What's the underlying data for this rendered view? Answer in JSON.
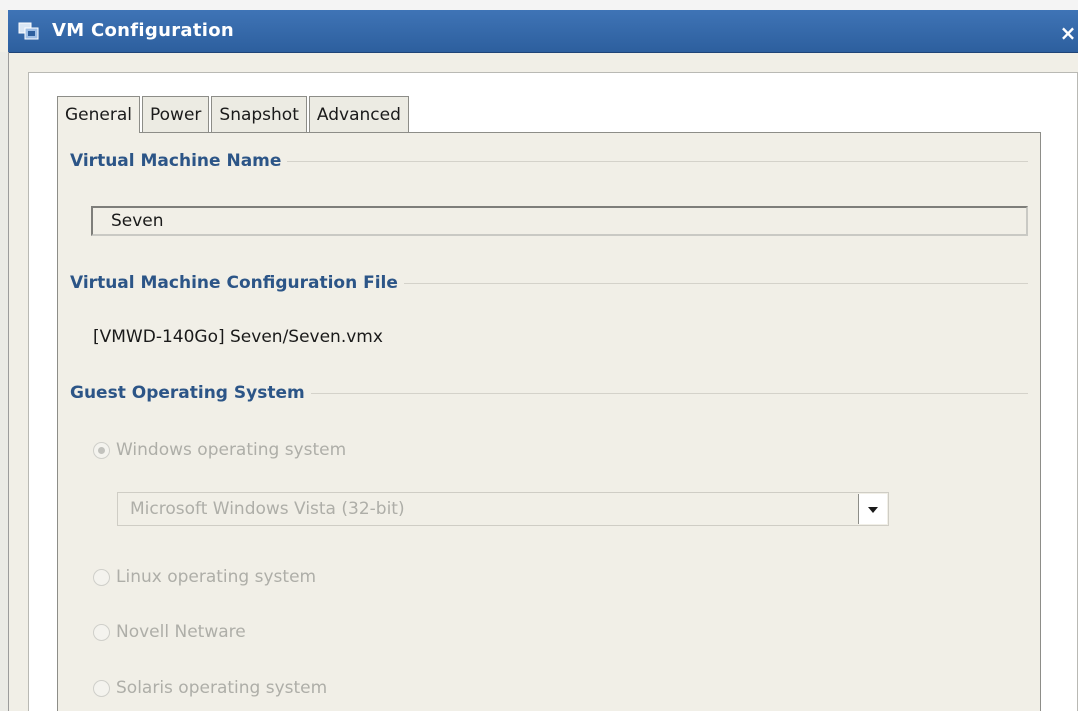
{
  "window": {
    "title": "VM Configuration",
    "close_label": "×"
  },
  "tabs": [
    {
      "label": "General",
      "active": true
    },
    {
      "label": "Power",
      "active": false
    },
    {
      "label": "Snapshot",
      "active": false
    },
    {
      "label": "Advanced",
      "active": false
    }
  ],
  "sections": {
    "vm_name": {
      "title": "Virtual Machine Name",
      "value": "Seven"
    },
    "config_file": {
      "title": "Virtual Machine Configuration File",
      "path": "[VMWD-140Go] Seven/Seven.vmx"
    },
    "guest_os": {
      "title": "Guest Operating System",
      "options": [
        {
          "label": "Windows operating system",
          "checked": true
        },
        {
          "label": "Linux operating system",
          "checked": false
        },
        {
          "label": "Novell Netware",
          "checked": false
        },
        {
          "label": "Solaris operating system",
          "checked": false
        }
      ],
      "windows_version": "Microsoft Windows Vista (32-bit)"
    }
  },
  "colors": {
    "titlebar": "#2d5f9e",
    "section_title": "#2c5587",
    "disabled_text": "#aeaea8"
  }
}
